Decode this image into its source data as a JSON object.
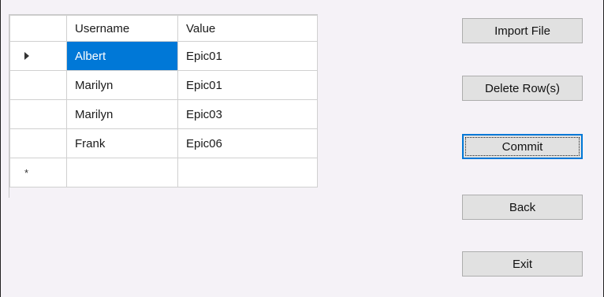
{
  "grid": {
    "columns": [
      "Username",
      "Value"
    ],
    "rows": [
      {
        "username": "Albert",
        "value": "Epic01",
        "current": true
      },
      {
        "username": "Marilyn",
        "value": "Epic01"
      },
      {
        "username": "Marilyn",
        "value": "Epic03"
      },
      {
        "username": "Frank",
        "value": "Epic06"
      }
    ],
    "new_row_marker": "*",
    "selection_color": "#0078d7"
  },
  "buttons": {
    "import_label": "Import File",
    "delete_label": "Delete Row(s)",
    "commit_label": "Commit",
    "back_label": "Back",
    "exit_label": "Exit"
  },
  "icons": {
    "current_row": "current-row-arrow-icon",
    "new_row": "new-row-asterisk-icon"
  }
}
